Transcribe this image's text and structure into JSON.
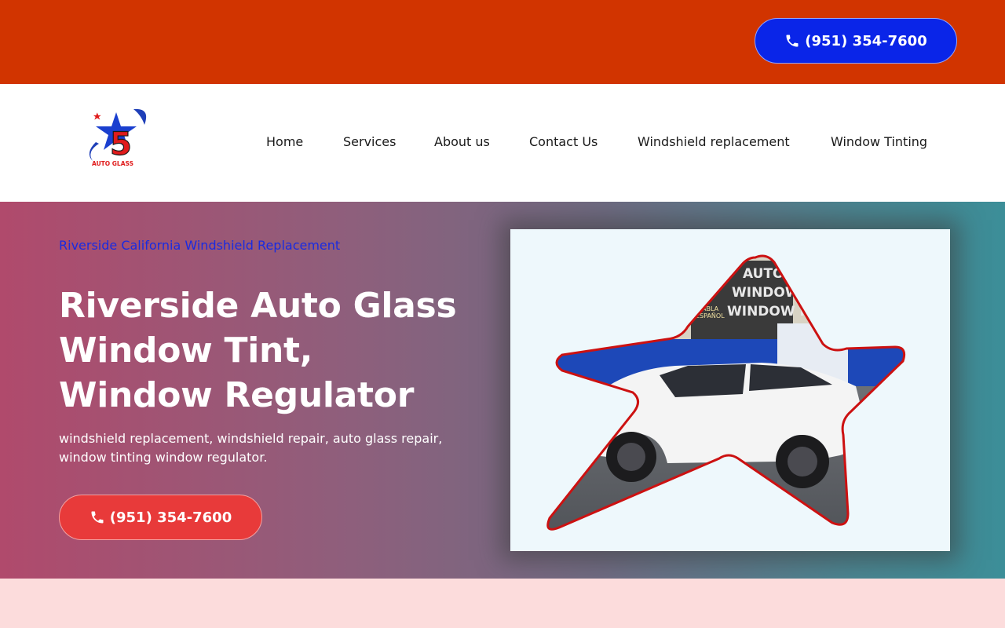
{
  "topbar": {
    "phone_label": "(951) 354-7600",
    "phone_icon": "phone-icon",
    "background_color": "#d13400",
    "button_color": "#0a25e8"
  },
  "header": {
    "logo": {
      "number": "5",
      "text": "AUTO GLASS"
    },
    "nav": [
      {
        "label": "Home"
      },
      {
        "label": "Services"
      },
      {
        "label": "About us"
      },
      {
        "label": "Contact Us"
      },
      {
        "label": "Windshield replacement"
      },
      {
        "label": "Window Tinting"
      }
    ]
  },
  "hero": {
    "eyebrow": "Riverside California Windshield Replacement",
    "title": "Riverside Auto Glass Window Tint, Window Regulator",
    "subtitle": "windshield replacement, windshield repair, auto glass repair, window tinting window regulator.",
    "cta_label": "(951) 354-7600",
    "cta_color": "#e83a3a",
    "image": {
      "shape": "star",
      "sign_lines": [
        "AUTO",
        "WINDOW",
        "WINDOW R"
      ],
      "sign_small": [
        "HABLA",
        "ESPAÑOL"
      ]
    }
  }
}
